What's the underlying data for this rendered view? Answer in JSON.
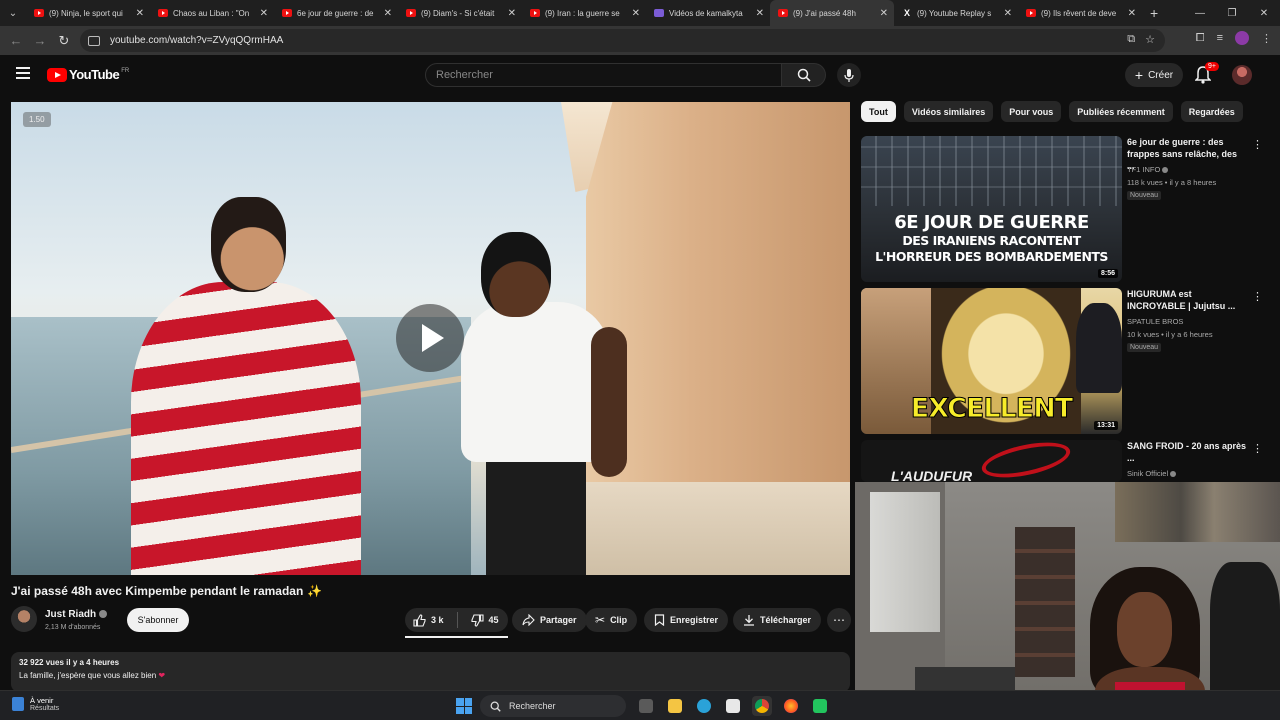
{
  "browser": {
    "tabs": [
      {
        "title": "(9) Ninja, le sport qui",
        "icon": "youtube-favicon",
        "active": false
      },
      {
        "title": "Chaos au Liban : \"On",
        "icon": "youtube-favicon",
        "active": false
      },
      {
        "title": "6e jour de guerre : de",
        "icon": "youtube-favicon",
        "active": false
      },
      {
        "title": "(9) Diam's - Si c'était",
        "icon": "youtube-favicon",
        "active": false
      },
      {
        "title": "(9) Iran : la guerre se",
        "icon": "youtube-favicon",
        "active": false
      },
      {
        "title": "Vidéos de kamalkyta",
        "icon": "twitch-favicon",
        "active": false
      },
      {
        "title": "(9) J'ai passé 48h",
        "icon": "youtube-favicon",
        "active": true
      },
      {
        "title": "(9) Youtube Replay s",
        "icon": "x-favicon",
        "active": false
      },
      {
        "title": "(9) Ils rêvent de deve",
        "icon": "youtube-favicon",
        "active": false
      }
    ],
    "url": "youtube.com/watch?v=ZVyqQQrmHAA"
  },
  "header": {
    "logo_text": "YouTube",
    "region": "FR",
    "search_placeholder": "Rechercher",
    "create_label": "Créer",
    "notif_count": "9+"
  },
  "player": {
    "speed_badge": "1.50"
  },
  "video": {
    "title": "J'ai passé 48h avec Kimpembe pendant le ramadan",
    "title_emoji": "✨",
    "channel": "Just Riadh",
    "subscribers": "2,13 M d'abonnés",
    "subscribe_label": "S'abonner",
    "likes": "3 k",
    "dislikes": "45",
    "share_label": "Partager",
    "clip_label": "Clip",
    "save_label": "Enregistrer",
    "download_label": "Télécharger",
    "views_time": "32 922 vues  il y a 4 heures",
    "description": "La famille, j'espère que vous allez bien",
    "description_emoji": "❤"
  },
  "sidebar": {
    "chips": [
      "Tout",
      "Vidéos similaires",
      "Pour vous",
      "Publiées récemment",
      "Regardées"
    ],
    "recommendations": [
      {
        "title": "6e jour de guerre : des frappes sans relâche, des ...",
        "channel": "TF1 INFO",
        "meta": "118 k vues • il y a 8 heures",
        "badge": "Nouveau",
        "duration": "8:56",
        "thumb_line1": "6E JOUR DE GUERRE",
        "thumb_line2": "DES IRANIENS RACONTENT",
        "thumb_line3": "L'HORREUR DES BOMBARDEMENTS"
      },
      {
        "title": "HIGURUMA est INCROYABLE | Jujutsu ...",
        "channel": "SPATULE BROS",
        "meta": "10 k vues • il y a 6 heures",
        "badge": "Nouveau",
        "duration": "13:31",
        "thumb_text": "EXCELLENT"
      },
      {
        "title": "SANG FROID - 20 ans après ...",
        "channel": "Sinik Officiel",
        "thumb_text": "L'AUDUFUR"
      }
    ]
  },
  "taskbar": {
    "weather_title": "À venir",
    "weather_sub": "Résultats",
    "search_label": "Rechercher",
    "apps": [
      "task-view",
      "file-explorer",
      "edge",
      "store",
      "chrome",
      "firefox",
      "green-app"
    ]
  }
}
